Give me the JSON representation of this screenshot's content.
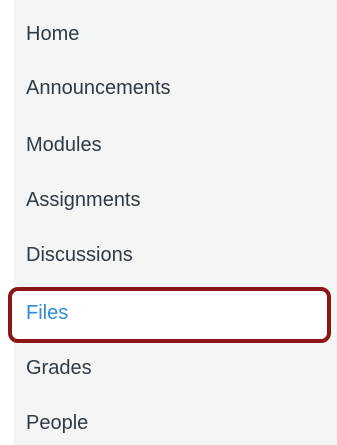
{
  "nav": {
    "items": [
      {
        "label": "Home"
      },
      {
        "label": "Announcements"
      },
      {
        "label": "Modules"
      },
      {
        "label": "Assignments"
      },
      {
        "label": "Discussions"
      },
      {
        "label": "Files",
        "active": true
      },
      {
        "label": "Grades"
      },
      {
        "label": "People"
      }
    ],
    "active_color": "#2f8ad8",
    "text_color": "#2d3b45",
    "highlight_color": "#8c1616"
  }
}
